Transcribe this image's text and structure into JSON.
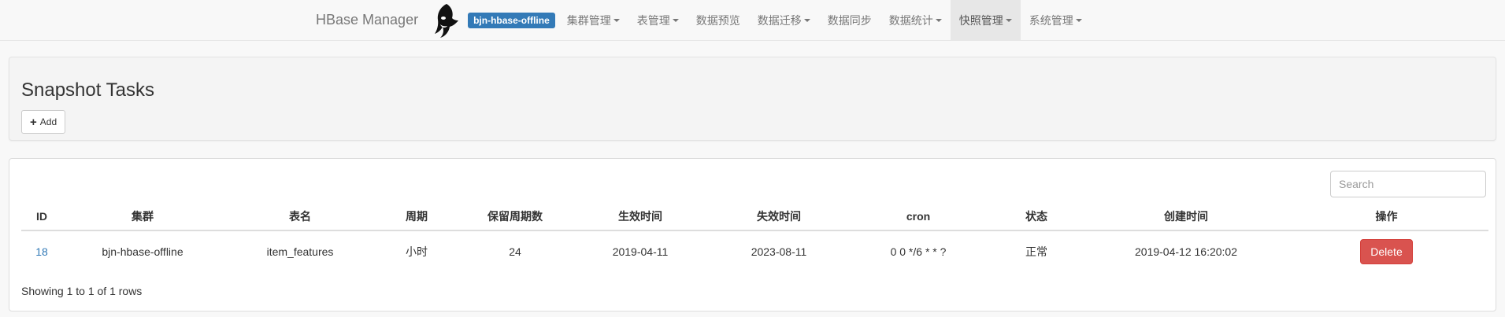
{
  "navbar": {
    "brand": "HBase Manager",
    "cluster_badge": "bjn-hbase-offline",
    "items": [
      {
        "label": "集群管理",
        "dropdown": true,
        "active": false
      },
      {
        "label": "表管理",
        "dropdown": true,
        "active": false
      },
      {
        "label": "数据预览",
        "dropdown": false,
        "active": false
      },
      {
        "label": "数据迁移",
        "dropdown": true,
        "active": false
      },
      {
        "label": "数据同步",
        "dropdown": false,
        "active": false
      },
      {
        "label": "数据统计",
        "dropdown": true,
        "active": false
      },
      {
        "label": "快照管理",
        "dropdown": true,
        "active": true
      },
      {
        "label": "系统管理",
        "dropdown": true,
        "active": false
      }
    ]
  },
  "header": {
    "title": "Snapshot Tasks",
    "add_label": "Add"
  },
  "table": {
    "search_placeholder": "Search",
    "columns": [
      "ID",
      "集群",
      "表名",
      "周期",
      "保留周期数",
      "生效时间",
      "失效时间",
      "cron",
      "状态",
      "创建时间",
      "操作"
    ],
    "rows": [
      {
        "id": "18",
        "cluster": "bjn-hbase-offline",
        "table": "item_features",
        "period": "小时",
        "retain": "24",
        "start": "2019-04-11",
        "end": "2023-08-11",
        "cron": "0 0 */6 * * ?",
        "status": "正常",
        "created": "2019-04-12 16:20:02",
        "action": "Delete"
      }
    ],
    "footer": "Showing 1 to 1 of 1 rows"
  },
  "colors": {
    "primary": "#337ab7",
    "danger": "#d9534f"
  }
}
